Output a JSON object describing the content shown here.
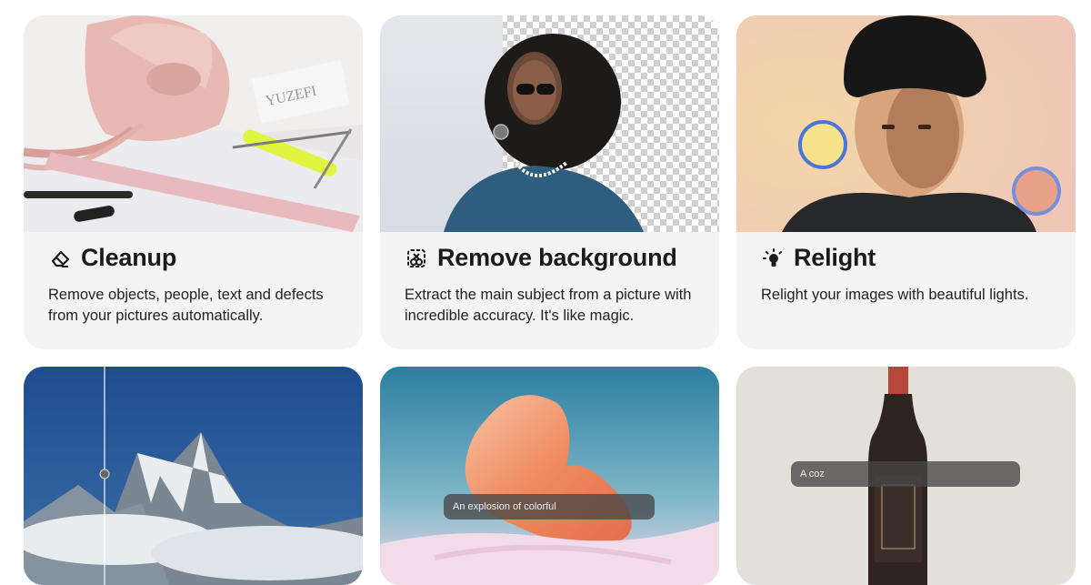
{
  "cards": [
    {
      "title": "Cleanup",
      "icon": "eraser-icon",
      "description": "Remove objects, people, text and defects from your pictures automatically."
    },
    {
      "title": "Remove background",
      "icon": "remove-background-icon",
      "description": "Extract the main subject from a picture with incredible accuracy. It's like magic."
    },
    {
      "title": "Relight",
      "icon": "lightbulb-icon",
      "description": "Relight your images with beautiful lights."
    }
  ],
  "bottom_cards": [
    {
      "image": "mountain-comparison-image"
    },
    {
      "image": "abstract-shape-image",
      "prompt": "An explosion of colorful"
    },
    {
      "image": "wine-bottle-image",
      "prompt": "A coz"
    }
  ]
}
